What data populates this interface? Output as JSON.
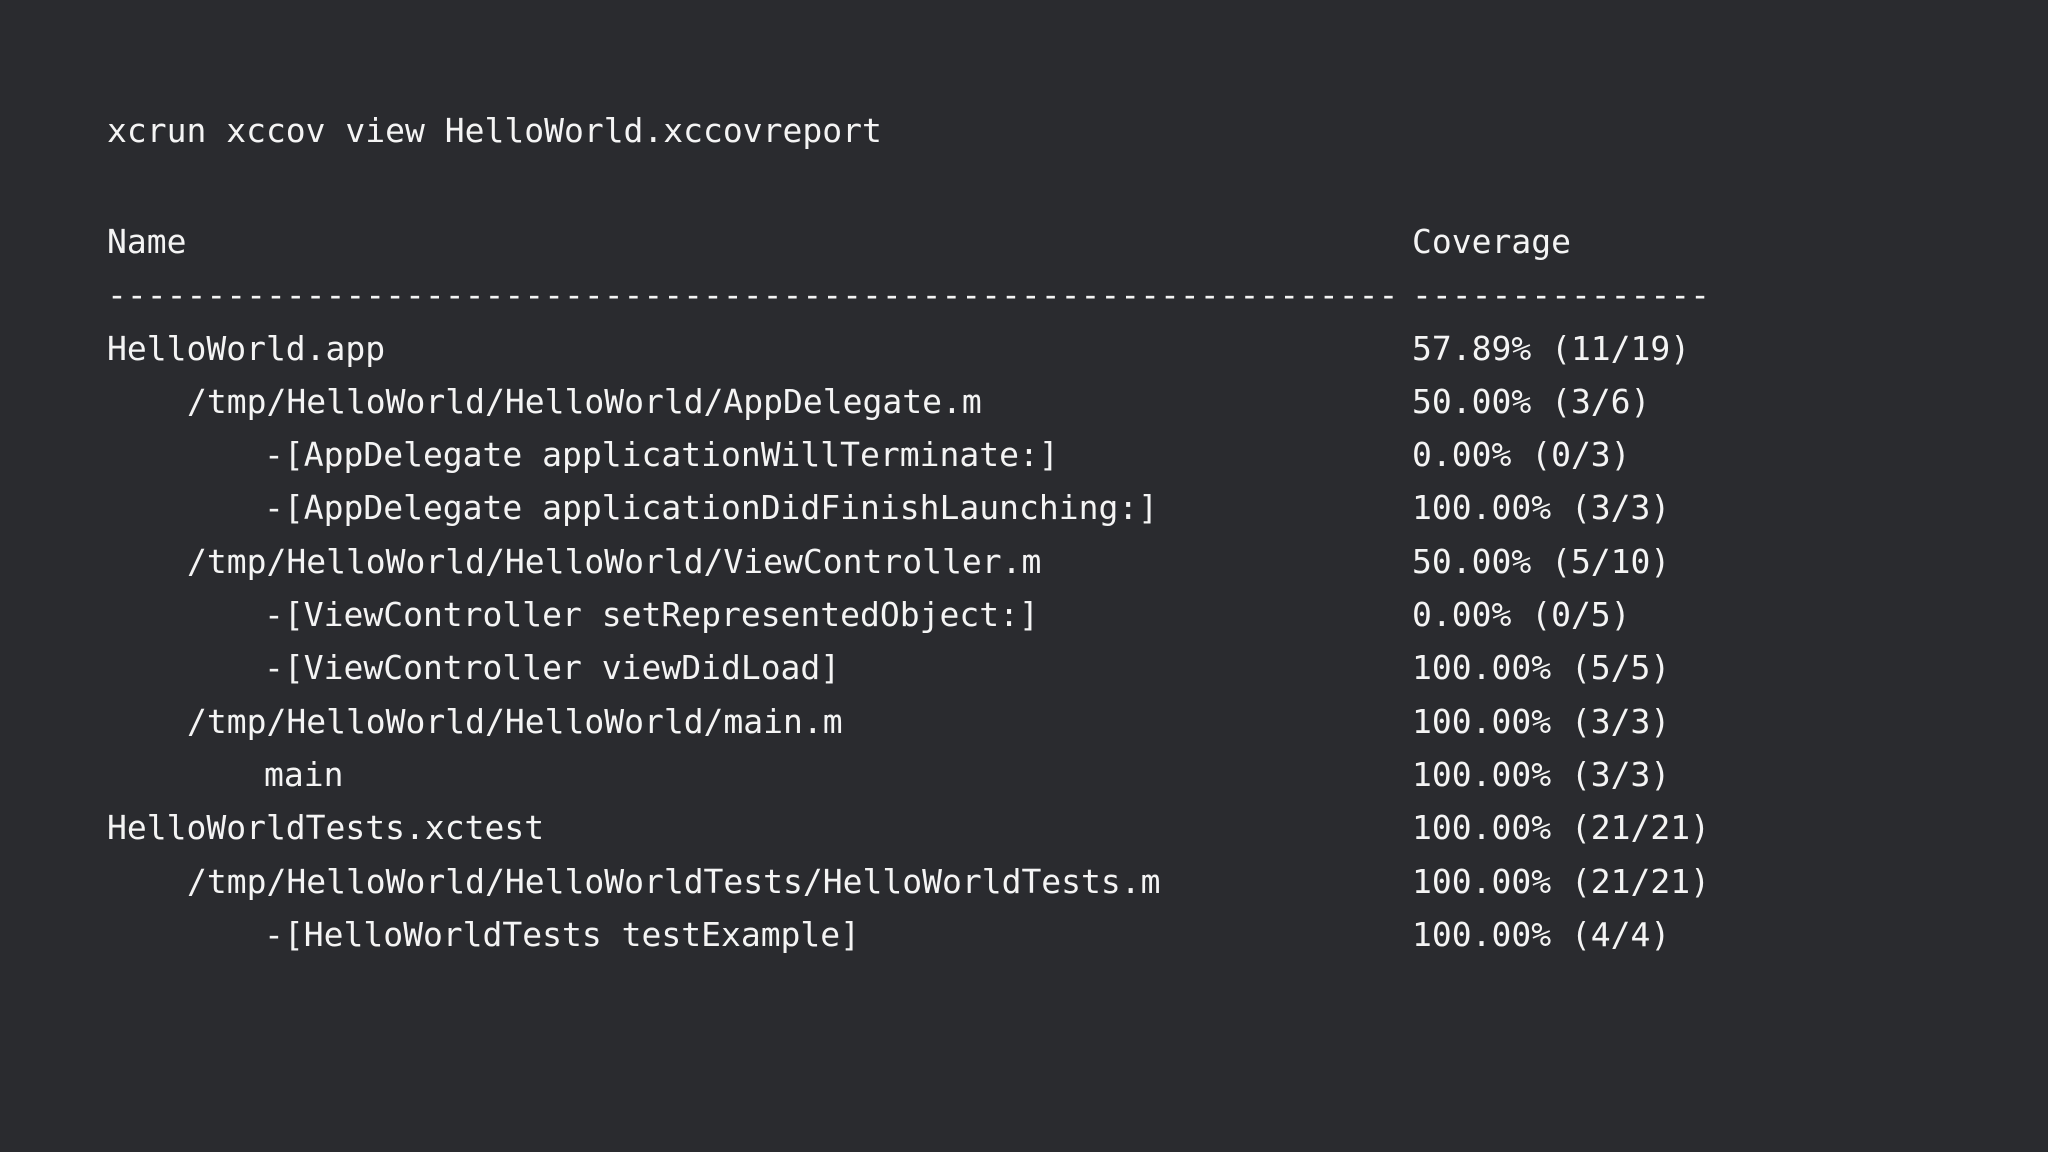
{
  "command": "xcrun xccov view HelloWorld.xccovreport",
  "header": {
    "name": "Name",
    "coverage": "Coverage",
    "name_rule": "-------------------------------------------------------------------------------",
    "coverage_rule": "----------------"
  },
  "rows": [
    {
      "name": "HelloWorld.app",
      "coverage": "57.89% (11/19)"
    },
    {
      "name": "/tmp/HelloWorld/HelloWorld/AppDelegate.m",
      "coverage": "50.00% (3/6)"
    },
    {
      "name": "-[AppDelegate applicationWillTerminate:]",
      "coverage": "0.00% (0/3)"
    },
    {
      "name": "-[AppDelegate applicationDidFinishLaunching:]",
      "coverage": "100.00% (3/3)"
    },
    {
      "name": "/tmp/HelloWorld/HelloWorld/ViewController.m",
      "coverage": "50.00% (5/10)"
    },
    {
      "name": "-[ViewController setRepresentedObject:]",
      "coverage": "0.00% (0/5)"
    },
    {
      "name": "-[ViewController viewDidLoad]",
      "coverage": "100.00% (5/5)"
    },
    {
      "name": "/tmp/HelloWorld/HelloWorld/main.m",
      "coverage": "100.00% (3/3)"
    },
    {
      "name": "main",
      "coverage": "100.00% (3/3)"
    },
    {
      "name": "HelloWorldTests.xctest",
      "coverage": "100.00% (21/21)"
    },
    {
      "name": "/tmp/HelloWorld/HelloWorldTests/HelloWorldTests.m",
      "coverage": "100.00% (21/21)"
    },
    {
      "name": "-[HelloWorldTests testExample]",
      "coverage": "100.00% (4/4)"
    }
  ]
}
